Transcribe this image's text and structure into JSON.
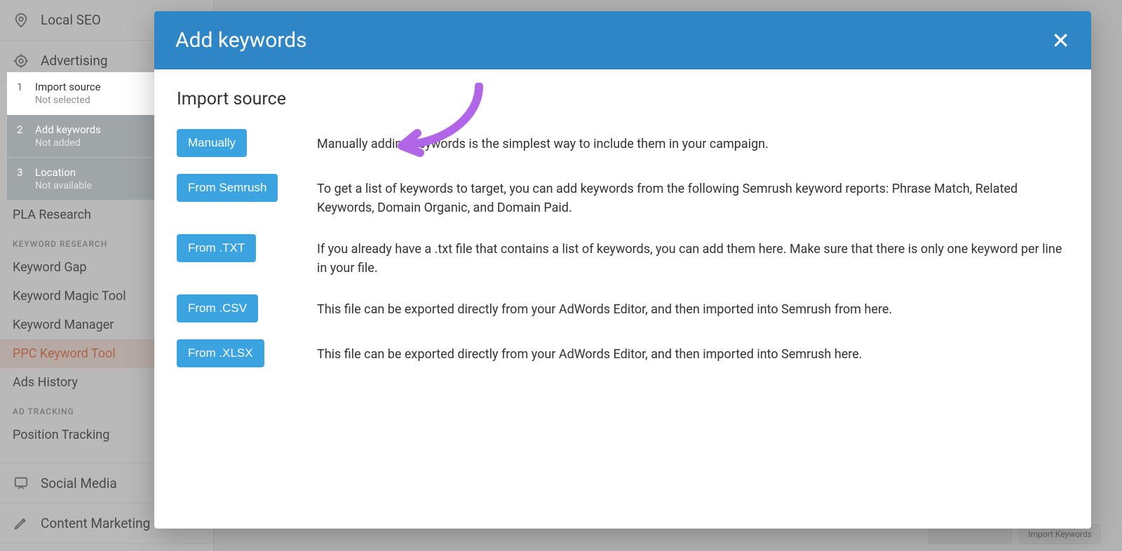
{
  "sidebar": {
    "top": [
      {
        "label": "Local SEO",
        "icon": "pin"
      },
      {
        "label": "Advertising",
        "icon": "target"
      }
    ],
    "items_upper": [
      {
        "label": "PLA Research"
      }
    ],
    "section1_title": "KEYWORD RESEARCH",
    "section1_items": [
      {
        "label": "Keyword Gap"
      },
      {
        "label": "Keyword Magic Tool"
      },
      {
        "label": "Keyword Manager"
      },
      {
        "label": "PPC Keyword Tool",
        "active": true
      },
      {
        "label": "Ads History"
      }
    ],
    "section2_title": "AD TRACKING",
    "section2_items": [
      {
        "label": "Position Tracking"
      }
    ],
    "bottom": [
      {
        "label": "Social Media",
        "icon": "chat"
      },
      {
        "label": "Content Marketing",
        "icon": "pencil"
      }
    ]
  },
  "background_bottom": {
    "chip1": "",
    "chip2": "Import Keywords"
  },
  "wizard": {
    "steps": [
      {
        "num": "1",
        "title": "Import source",
        "sub": "Not selected",
        "active": true
      },
      {
        "num": "2",
        "title": "Add keywords",
        "sub": "Not added",
        "active": false
      },
      {
        "num": "3",
        "title": "Location",
        "sub": "Not available",
        "active": false
      }
    ]
  },
  "modal": {
    "title": "Add keywords",
    "section_heading": "Import source",
    "options": [
      {
        "button": "Manually",
        "desc": "Manually adding keywords is the simplest way to include them in your campaign."
      },
      {
        "button": "From Semrush",
        "desc": "To get a list of keywords to target, you can add keywords from the following Semrush keyword reports: Phrase Match, Related Keywords, Domain Organic, and Domain Paid."
      },
      {
        "button": "From .TXT",
        "desc": "If you already have a .txt file that contains a list of keywords, you can add them here. Make sure that there is only one keyword per line in your file."
      },
      {
        "button": "From .CSV",
        "desc": "This file can be exported directly from your AdWords Editor, and then imported into Semrush from here."
      },
      {
        "button": "From .XLSX",
        "desc": "This file can be exported directly from your AdWords Editor, and then imported into Semrush here."
      }
    ]
  }
}
